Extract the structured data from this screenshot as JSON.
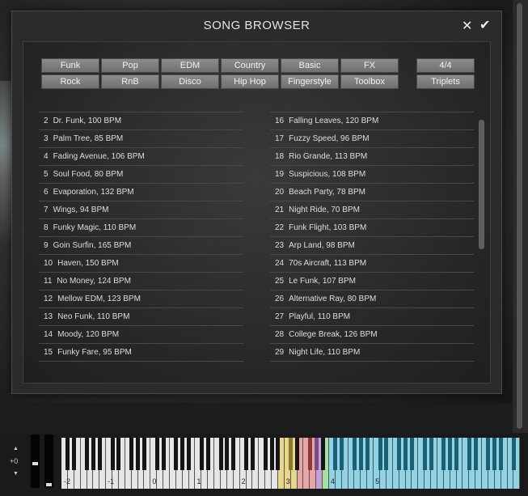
{
  "dialog": {
    "title": "SONG BROWSER",
    "close_glyph": "✕",
    "ok_glyph": "✔"
  },
  "genres": {
    "row1": [
      "Funk",
      "Pop",
      "EDM",
      "Country",
      "Basic",
      "FX"
    ],
    "row2": [
      "Rock",
      "RnB",
      "Disco",
      "Hip Hop",
      "Fingerstyle",
      "Toolbox"
    ]
  },
  "meter": [
    "4/4",
    "Triplets"
  ],
  "songs_left": [
    {
      "num": "2",
      "name": "Dr. Funk, 100 BPM"
    },
    {
      "num": "3",
      "name": "Palm Tree, 85 BPM"
    },
    {
      "num": "4",
      "name": "Fading Avenue, 106 BPM"
    },
    {
      "num": "5",
      "name": "Soul Food, 80 BPM"
    },
    {
      "num": "6",
      "name": "Evaporation, 132 BPM"
    },
    {
      "num": "7",
      "name": "Wings, 94 BPM"
    },
    {
      "num": "8",
      "name": "Funky Magic, 110 BPM"
    },
    {
      "num": "9",
      "name": "Goin Surfin, 165 BPM"
    },
    {
      "num": "10",
      "name": "Haven, 150 BPM"
    },
    {
      "num": "11",
      "name": "No Money, 124 BPM"
    },
    {
      "num": "12",
      "name": "Mellow EDM, 123 BPM"
    },
    {
      "num": "13",
      "name": "Neo Funk, 110 BPM"
    },
    {
      "num": "14",
      "name": "Moody, 120 BPM"
    },
    {
      "num": "15",
      "name": "Funky Fare, 95 BPM"
    }
  ],
  "songs_right": [
    {
      "num": "16",
      "name": "Falling Leaves, 120 BPM"
    },
    {
      "num": "17",
      "name": "Fuzzy Speed, 96 BPM"
    },
    {
      "num": "18",
      "name": "Rio Grande, 113 BPM"
    },
    {
      "num": "19",
      "name": "Suspicious, 108 BPM"
    },
    {
      "num": "20",
      "name": "Beach Party, 78 BPM"
    },
    {
      "num": "21",
      "name": "Night Ride, 70 BPM"
    },
    {
      "num": "22",
      "name": "Funk Flight, 103 BPM"
    },
    {
      "num": "23",
      "name": "Arp Land, 98 BPM"
    },
    {
      "num": "24",
      "name": "70s Aircraft, 113 BPM"
    },
    {
      "num": "25",
      "name": "Le Funk, 107 BPM"
    },
    {
      "num": "26",
      "name": "Alternative Ray, 80 BPM"
    },
    {
      "num": "27",
      "name": "Playful, 110 BPM"
    },
    {
      "num": "28",
      "name": "College Break, 126 BPM"
    },
    {
      "num": "29",
      "name": "Night Life, 110 BPM"
    }
  ],
  "keyboard": {
    "transpose_label": "+0",
    "up_glyph": "▲",
    "down_glyph": "▼",
    "octave_labels": [
      "-2",
      "-1",
      "0",
      "1",
      "2",
      "3",
      "4",
      "5"
    ],
    "zone_colors": {
      "white": "#e6e6e6",
      "yellow": "#e8d78a",
      "red": "#e8a5a5",
      "purple": "#c8a0d8",
      "green": "#a8e0a0",
      "cyan": "#8fd3e6"
    }
  }
}
